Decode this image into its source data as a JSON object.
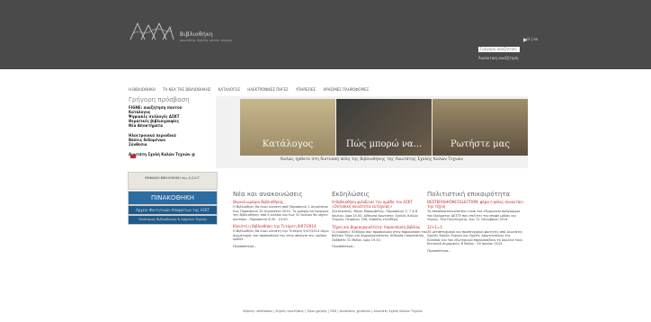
{
  "brand": {
    "name": "Βιβλιοθήκη",
    "subtitle": "ανωτάτης σχολής καλών τεχνών"
  },
  "search": {
    "placeholder": "Γρήγορη αναζήτηση",
    "go": "▶",
    "advanced": "Αναλυτική αναζήτηση"
  },
  "lang": "ελ | en",
  "nav": [
    "Η ΒΙΒΛΙΟΘΗΚΗ",
    "ΤΑ ΝΕΑ ΤΗΣ ΒΙΒΛΙΟΘΗΚΗΣ",
    "ΚΑΤΑΛΟΓΟΣ",
    "ΗΛΕΚΤΡΟΝΙΚΕΣ ΠΗΓΕΣ",
    "ΥΠΗΡΕΣΙΕΣ",
    "ΧΡΗΣΙΜΕΣ ΠΛΗΡΟΦΟΡΙΕΣ"
  ],
  "quick": {
    "heading": "Γρήγορη πρόσβαση",
    "group1": [
      "FIGNE: αναζήτηση παντού",
      "Κατάλογος",
      "Ψηφιακές συλλογές ΑΣΚΤ",
      "Θεματικές βιβλιογραφίες",
      "Νέα Αποκτήματα"
    ],
    "group2": [
      "Ηλεκτρονικά περιοδικά",
      "Βάσεις δεδομένων",
      "Σύνθεσιο"
    ],
    "group3": [
      "Ανωτάτη Σχολή Καλών Τεχνών @"
    ]
  },
  "banners": [
    "ΨΗΦΙΑΚΗ ΒΙΒΛΙΟΘΗΚΗ της Α.Σ.Κ.Τ.",
    "ΠΙΝΑΚΟΘΗΚΗ",
    "Αρχείο Φοιτητικών Αποφοίτων της ΑΣΚΤ",
    "Σύνδεσμος Βιβλιοθηκών & Αρχείων Τεχνών"
  ],
  "hero": {
    "panels": [
      "Κατάλογος",
      "Πώς μπορώ να...",
      "Ρωτήστε μας"
    ],
    "tagline": "Καλώς ήρθατε στη δικτυακή πύλη της Βιβλιοθήκης της Ανωτάτης Σχολής Καλών Τεχνών"
  },
  "columns": [
    {
      "heading": "Νέα και ανακοινώσεις",
      "items": [
        {
          "title": "Θερινό ωράριο Βιβλιοθήκης",
          "text": "Η Βιβλιοθήκη θα είναι κλειστή από Παρασκευή 1 Αυγούστου έως Παρασκευή 15 Αυγούστου 2014. Το ωράριο λειτουργίας της Βιβλιοθήκης από 4 Ιουλίου και έως 31 Ιουλίου θα ισχύει: Δευτέρα - Παρασκευή 8.30 - 15.00."
        },
        {
          "title": "Κλειστή η Βιβλιοθήκη την Τετάρτη 9/07/2014",
          "text": "Η Βιβλιοθήκη θα είναι κλειστή την Τετάρτη 9/07/2014 λόγω συμμετοχής του προσωπικού της στην απεργία της ημέρας ΑΔΕΔΥ."
        }
      ],
      "more": "Περισσότερα..."
    },
    {
      "heading": "Εκδηλώσεις",
      "items": [
        {
          "title": "Η Βιβλιοθήκη φιλοξενεί την ομάδα του ΑΣΚΤ «Ουτοπική κοινότητα ευτεχνίας»",
          "text": "Συντονιστής: Νίκος Μαραμβέλης. Παρασκευή 3, 7 & 8 Ιουλίου, ώρα 20.00, Αίθουσα Ανωτάτης Σχολής Καλών Τεχνών, Πειραιώς 256, Είσοδος ελεύθερη."
        },
        {
          "title": "Τέχνη και Δημιουργικότητα: παρουσίαση βιβλίου",
          "text": "Οι εκδόσεις Πλέθρον σας προσκαλούν στην παρουσίαση του βιβλίου Τέχνη και Δημιουργικότητα. Αίθουσα Cooperativa, Σαββάτο 31 Μαΐου, ώρα 19.30."
        }
      ],
      "more": "Περισσότερα..."
    },
    {
      "heading": "Πολιτιστική επικαιρότητα",
      "items": [
        {
          "title": "DESTEFASHIONCOLLECTION: φόρα ο φίλος συναντάει την τέχνη",
          "text": "Το destefashioncollection είναι ένα εξαμηνιαίο πρόγραμμα του Ιδρύματος ΔΕΣΤΕ που επιζητεί την επαφή μόδας και τέχνης. Στο Πολυτεχνείο, έως 11 Οκτωβρίου 2014."
        },
        {
          "title": "12+1=1",
          "text": "30 μεταπτυχιακοί και προπτυχιακοί φοιτητές από Ανωτάτες Σχολές Καλών Τεχνών και Σχολές Αρχιτεκτόνων της Ελλάδας και του εξωτερικού παρουσιάζουν τη δουλειά τους. Κεντρικό Δημαρχείο, 8 Μαΐου - 29 Ιουνίου 2014."
        }
      ],
      "more": "Περισσότερα..."
    }
  ],
  "footer": "Χάρτης ιστότοπου | Συχνές ερωτήσεις | Όροι χρήσης | RSS | συνδέσεις χρηστών | Ανωτάτη Σχολή Καλών Τεχνών"
}
